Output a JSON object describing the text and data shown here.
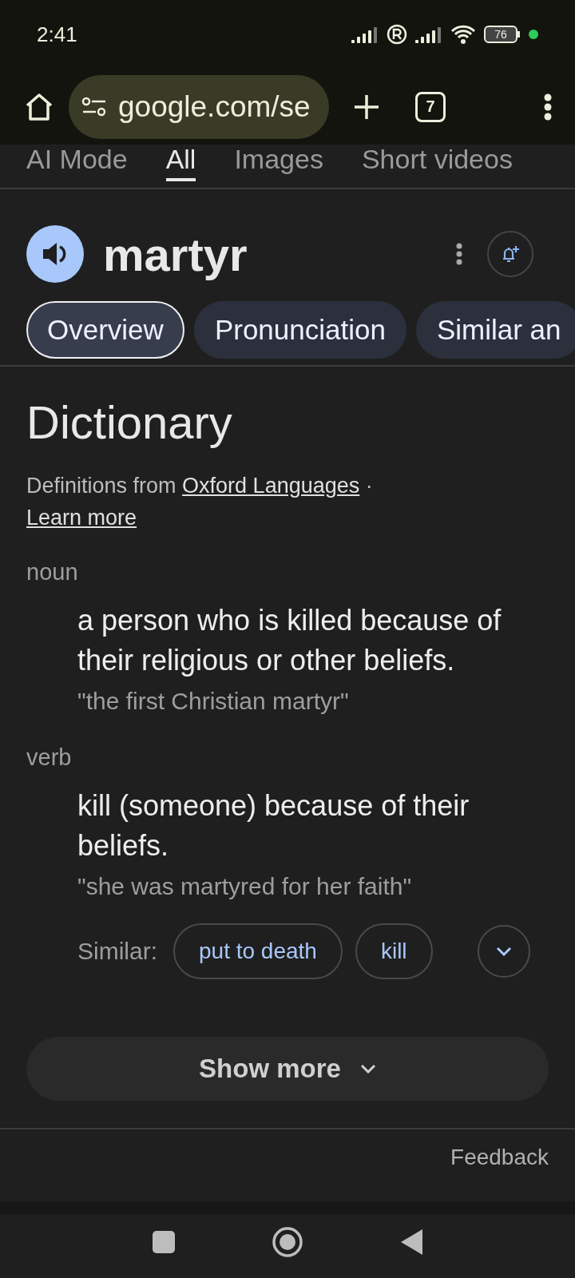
{
  "status_bar": {
    "time": "2:41",
    "battery": "76"
  },
  "browser_toolbar": {
    "url": "google.com/se",
    "tab_count": "7"
  },
  "search_tabs": [
    {
      "label": "AI Mode",
      "selected": false
    },
    {
      "label": "All",
      "selected": true
    },
    {
      "label": "Images",
      "selected": false
    },
    {
      "label": "Short videos",
      "selected": false
    }
  ],
  "entry": {
    "word": "martyr"
  },
  "chips": [
    {
      "label": "Overview",
      "selected": true
    },
    {
      "label": "Pronunciation",
      "selected": false
    },
    {
      "label": "Similar an",
      "selected": false
    }
  ],
  "dictionary": {
    "title": "Dictionary",
    "source_prefix": "Definitions from",
    "source_link": "Oxford Languages",
    "separator": "·",
    "learn_more": "Learn more",
    "senses": [
      {
        "part_of_speech": "noun",
        "definition": "a person who is killed because of their religious or other beliefs.",
        "example": "\"the first Christian martyr\""
      },
      {
        "part_of_speech": "verb",
        "definition": "kill (someone) because of their beliefs.",
        "example": "\"she was martyred for her faith\""
      }
    ],
    "similar_label": "Similar:",
    "similar": [
      "put to death",
      "kill"
    ],
    "show_more": "Show more"
  },
  "feedback": "Feedback"
}
